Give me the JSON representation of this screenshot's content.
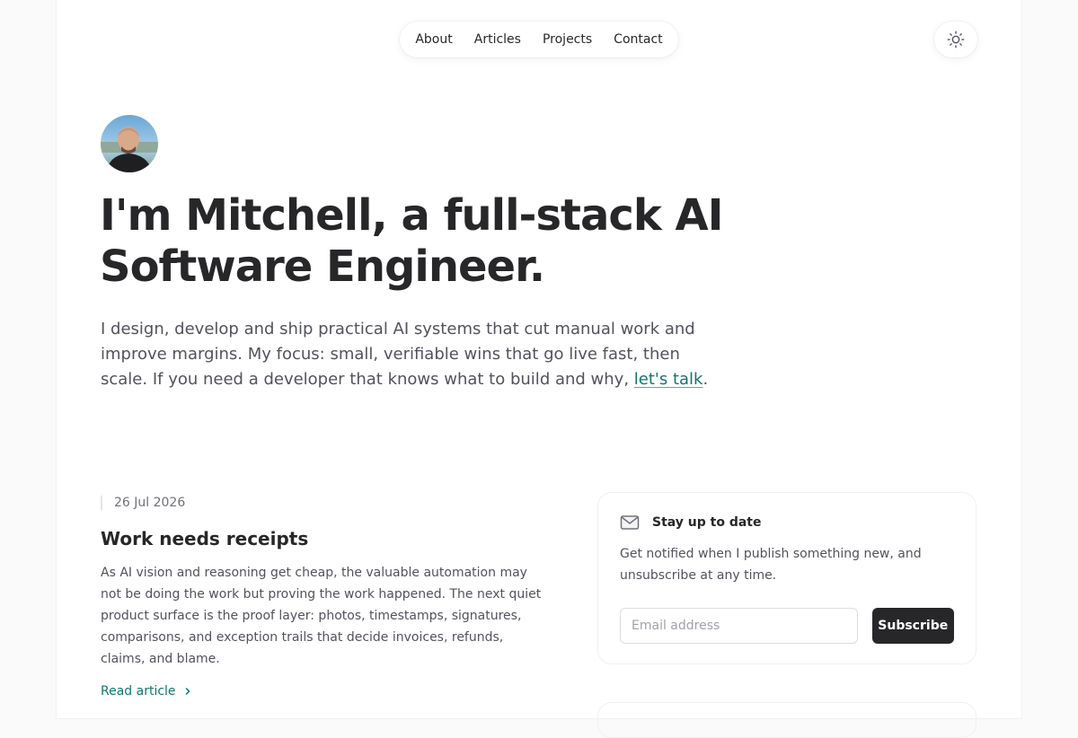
{
  "nav": {
    "items": [
      {
        "label": "About"
      },
      {
        "label": "Articles"
      },
      {
        "label": "Projects"
      },
      {
        "label": "Contact"
      }
    ],
    "theme_icon": "sun-icon"
  },
  "hero": {
    "title": "I'm Mitchell, a full-stack AI Software Engineer.",
    "intro_text": "I design, develop and ship practical AI systems that cut manual work and improve margins. My focus: small, verifiable wins that go live fast, then scale. If you need a developer that knows what to build and why, ",
    "intro_link": "let's talk",
    "intro_end": "."
  },
  "article": {
    "date": "26 Jul 2026",
    "title": "Work needs receipts",
    "excerpt": "As AI vision and reasoning get cheap, the valuable automation may not be doing the work but proving the work happened. The next quiet product surface is the proof layer: photos, timestamps, signatures, comparisons, and exception trails that decide invoices, refunds, claims, and blame.",
    "read_more": "Read article"
  },
  "newsletter": {
    "icon": "mail-icon",
    "title": "Stay up to date",
    "text": "Get notified when I publish something new, and unsubscribe at any time.",
    "placeholder": "Email address",
    "button": "Subscribe"
  },
  "colors": {
    "accent": "#0f766e",
    "dark": "#27272a"
  }
}
